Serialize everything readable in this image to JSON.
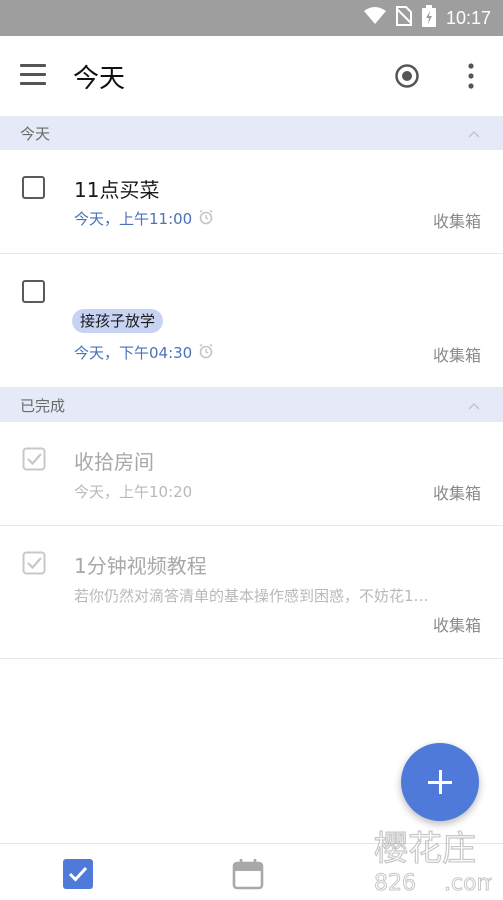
{
  "status_bar": {
    "time": "10:17"
  },
  "app_bar": {
    "title": "今天"
  },
  "sections": [
    {
      "label": "今天",
      "collapsed": false
    },
    {
      "label": "已完成",
      "collapsed": false
    }
  ],
  "tasks_today": [
    {
      "title": "11点买菜",
      "tag": "",
      "due": "今天，上午11:00",
      "has_reminder": true,
      "list": "收集箱",
      "checked": false
    },
    {
      "title": "",
      "tag": "接孩子放学",
      "due": "今天，下午04:30",
      "has_reminder": true,
      "list": "收集箱",
      "checked": false
    }
  ],
  "tasks_completed": [
    {
      "title": "收拾房间",
      "meta": "今天，上午10:20",
      "list": "收集箱",
      "checked": true
    },
    {
      "title": "1分钟视频教程",
      "description": "若你仍然对滴答清单的基本操作感到困惑，不妨花1…",
      "list": "收集箱",
      "checked": true
    }
  ],
  "bottom_nav": [
    {
      "name": "tasks",
      "icon": "check-square-icon",
      "active": true
    },
    {
      "name": "calendar",
      "icon": "calendar-icon",
      "active": false
    }
  ],
  "colors": {
    "accent": "#4f7ad9",
    "section_bg": "#e6eaf8",
    "due_text": "#4a72b8",
    "tag_bg": "#c8d3f4"
  },
  "watermark": {
    "line1": "樱花庄",
    "line2": "826"
  }
}
